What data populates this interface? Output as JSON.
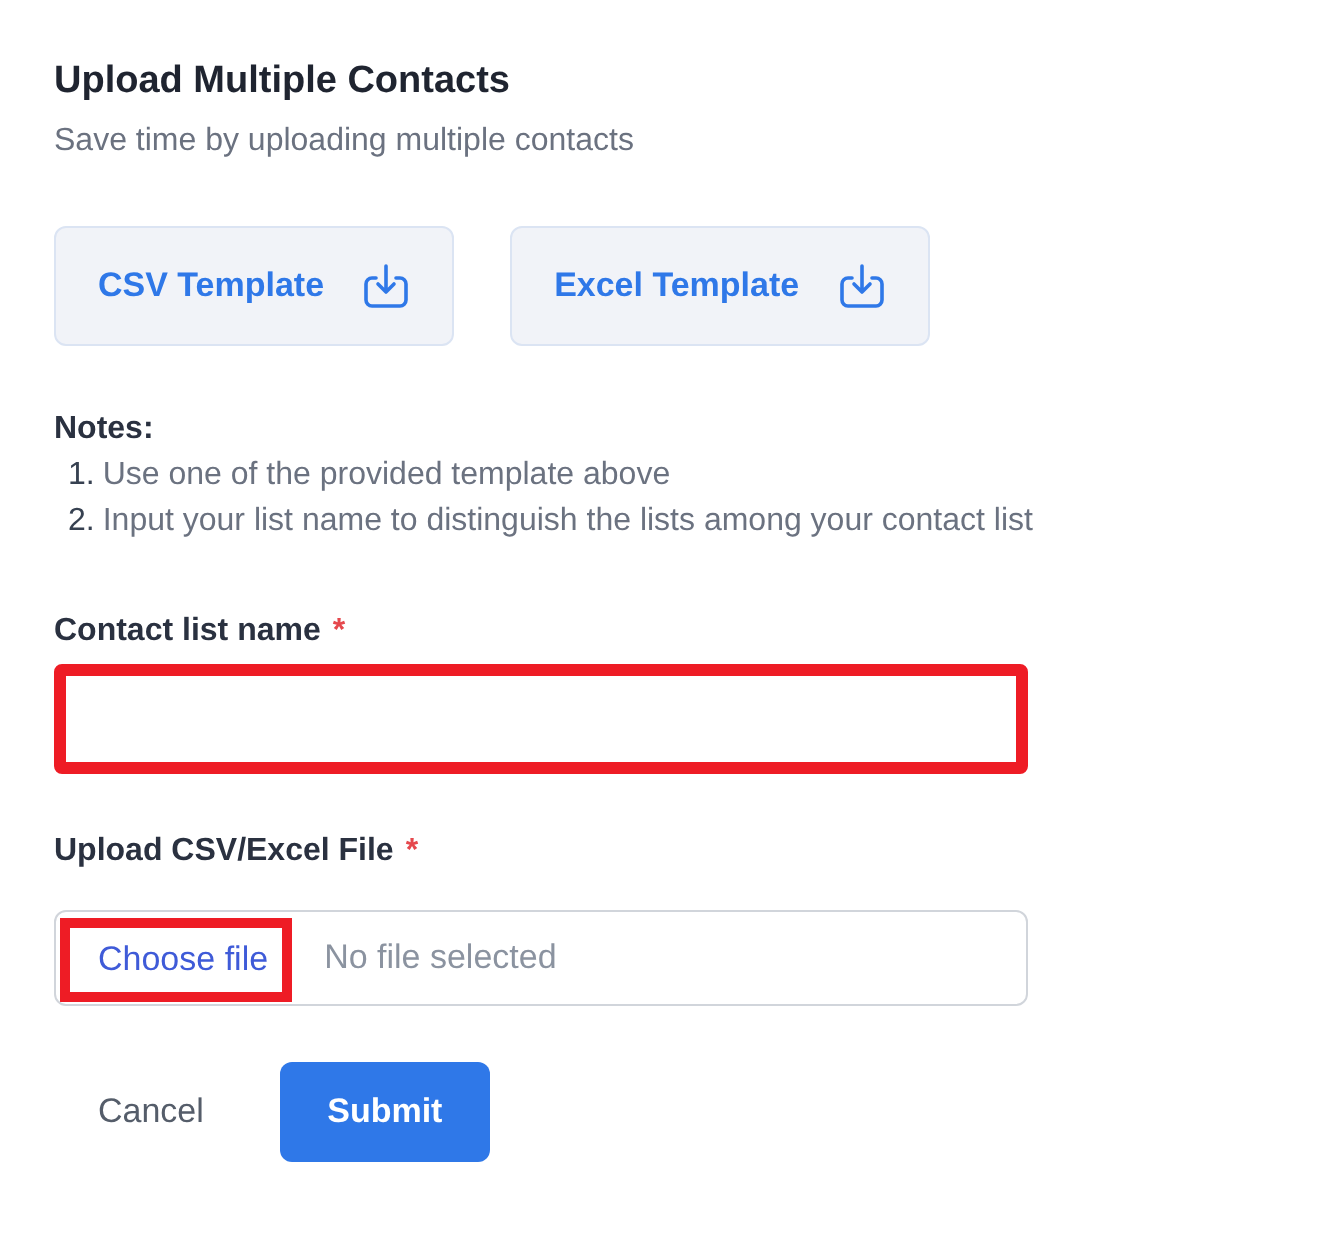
{
  "title": "Upload Multiple Contacts",
  "subtitle": "Save time by uploading multiple contacts",
  "templates": [
    {
      "label": "CSV Template"
    },
    {
      "label": "Excel Template"
    }
  ],
  "notes": {
    "heading": "Notes:",
    "items": [
      {
        "number": "1.",
        "text": "Use one of the provided template above"
      },
      {
        "number": "2.",
        "text": "Input your list name to distinguish the lists among your contact list"
      }
    ]
  },
  "list_name": {
    "label": "Contact list name",
    "required_mark": "*",
    "highlighted": true
  },
  "file_upload": {
    "label": "Upload CSV/Excel File",
    "required_mark": "*",
    "button": "Choose file",
    "status": "No file selected",
    "highlighted": true
  },
  "buttons": [
    {
      "kind": "link",
      "label": "Cancel"
    },
    {
      "kind": "primary",
      "label": "Submit"
    }
  ]
}
